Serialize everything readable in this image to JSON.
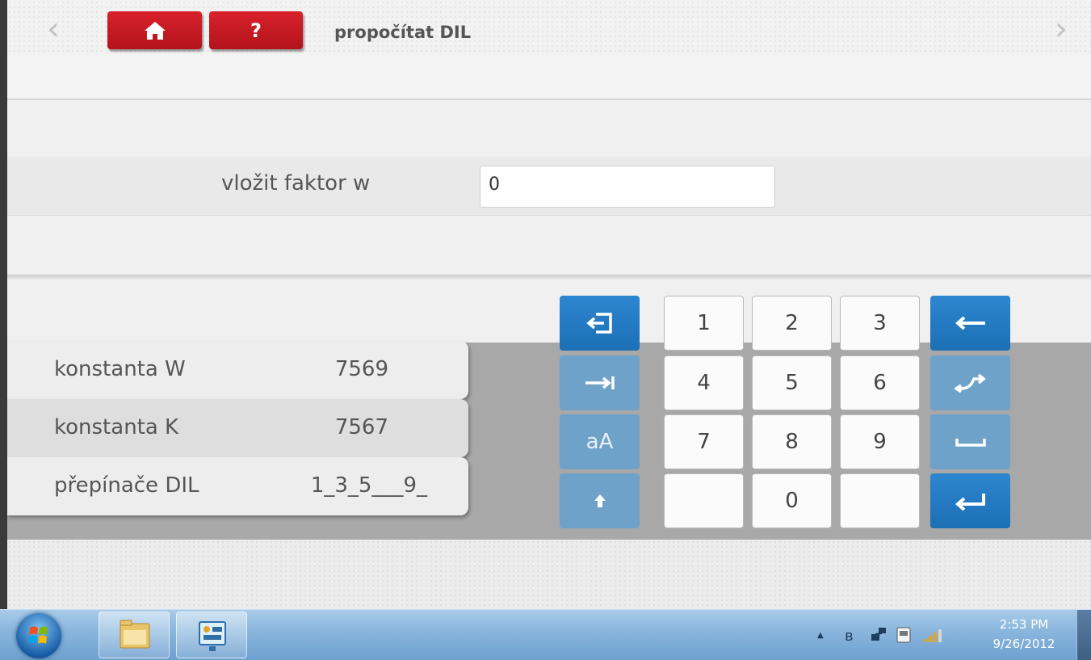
{
  "header": {
    "back_glyph": "‹",
    "forward_glyph": "›",
    "help_label": "?",
    "title": "propočítat DIL"
  },
  "form": {
    "label": "vložit faktor w",
    "input_value": "0"
  },
  "info": {
    "rows": [
      {
        "label": "konstanta W",
        "value": "7569"
      },
      {
        "label": "konstanta K",
        "value": "7567"
      },
      {
        "label": "přepínače DIL",
        "value": "1_3_5___9_"
      }
    ]
  },
  "keypad": {
    "digits": [
      "1",
      "2",
      "3",
      "4",
      "5",
      "6",
      "7",
      "8",
      "9",
      "0"
    ],
    "case_label": "aA",
    "icons": [
      "exit-icon",
      "tab-icon",
      "case-icon",
      "shift-icon",
      "backspace-icon",
      "swap-icon",
      "space-icon",
      "enter-icon"
    ]
  },
  "taskbar": {
    "tray_up": "▲",
    "bluetooth": "ʙ",
    "time": "2:53 PM",
    "date": "9/26/2012"
  },
  "colors": {
    "accent_red": "#c8141e",
    "key_blue": "#1f74ba",
    "key_faded": "#6fa2c8",
    "taskbar": "#8bb7de"
  }
}
